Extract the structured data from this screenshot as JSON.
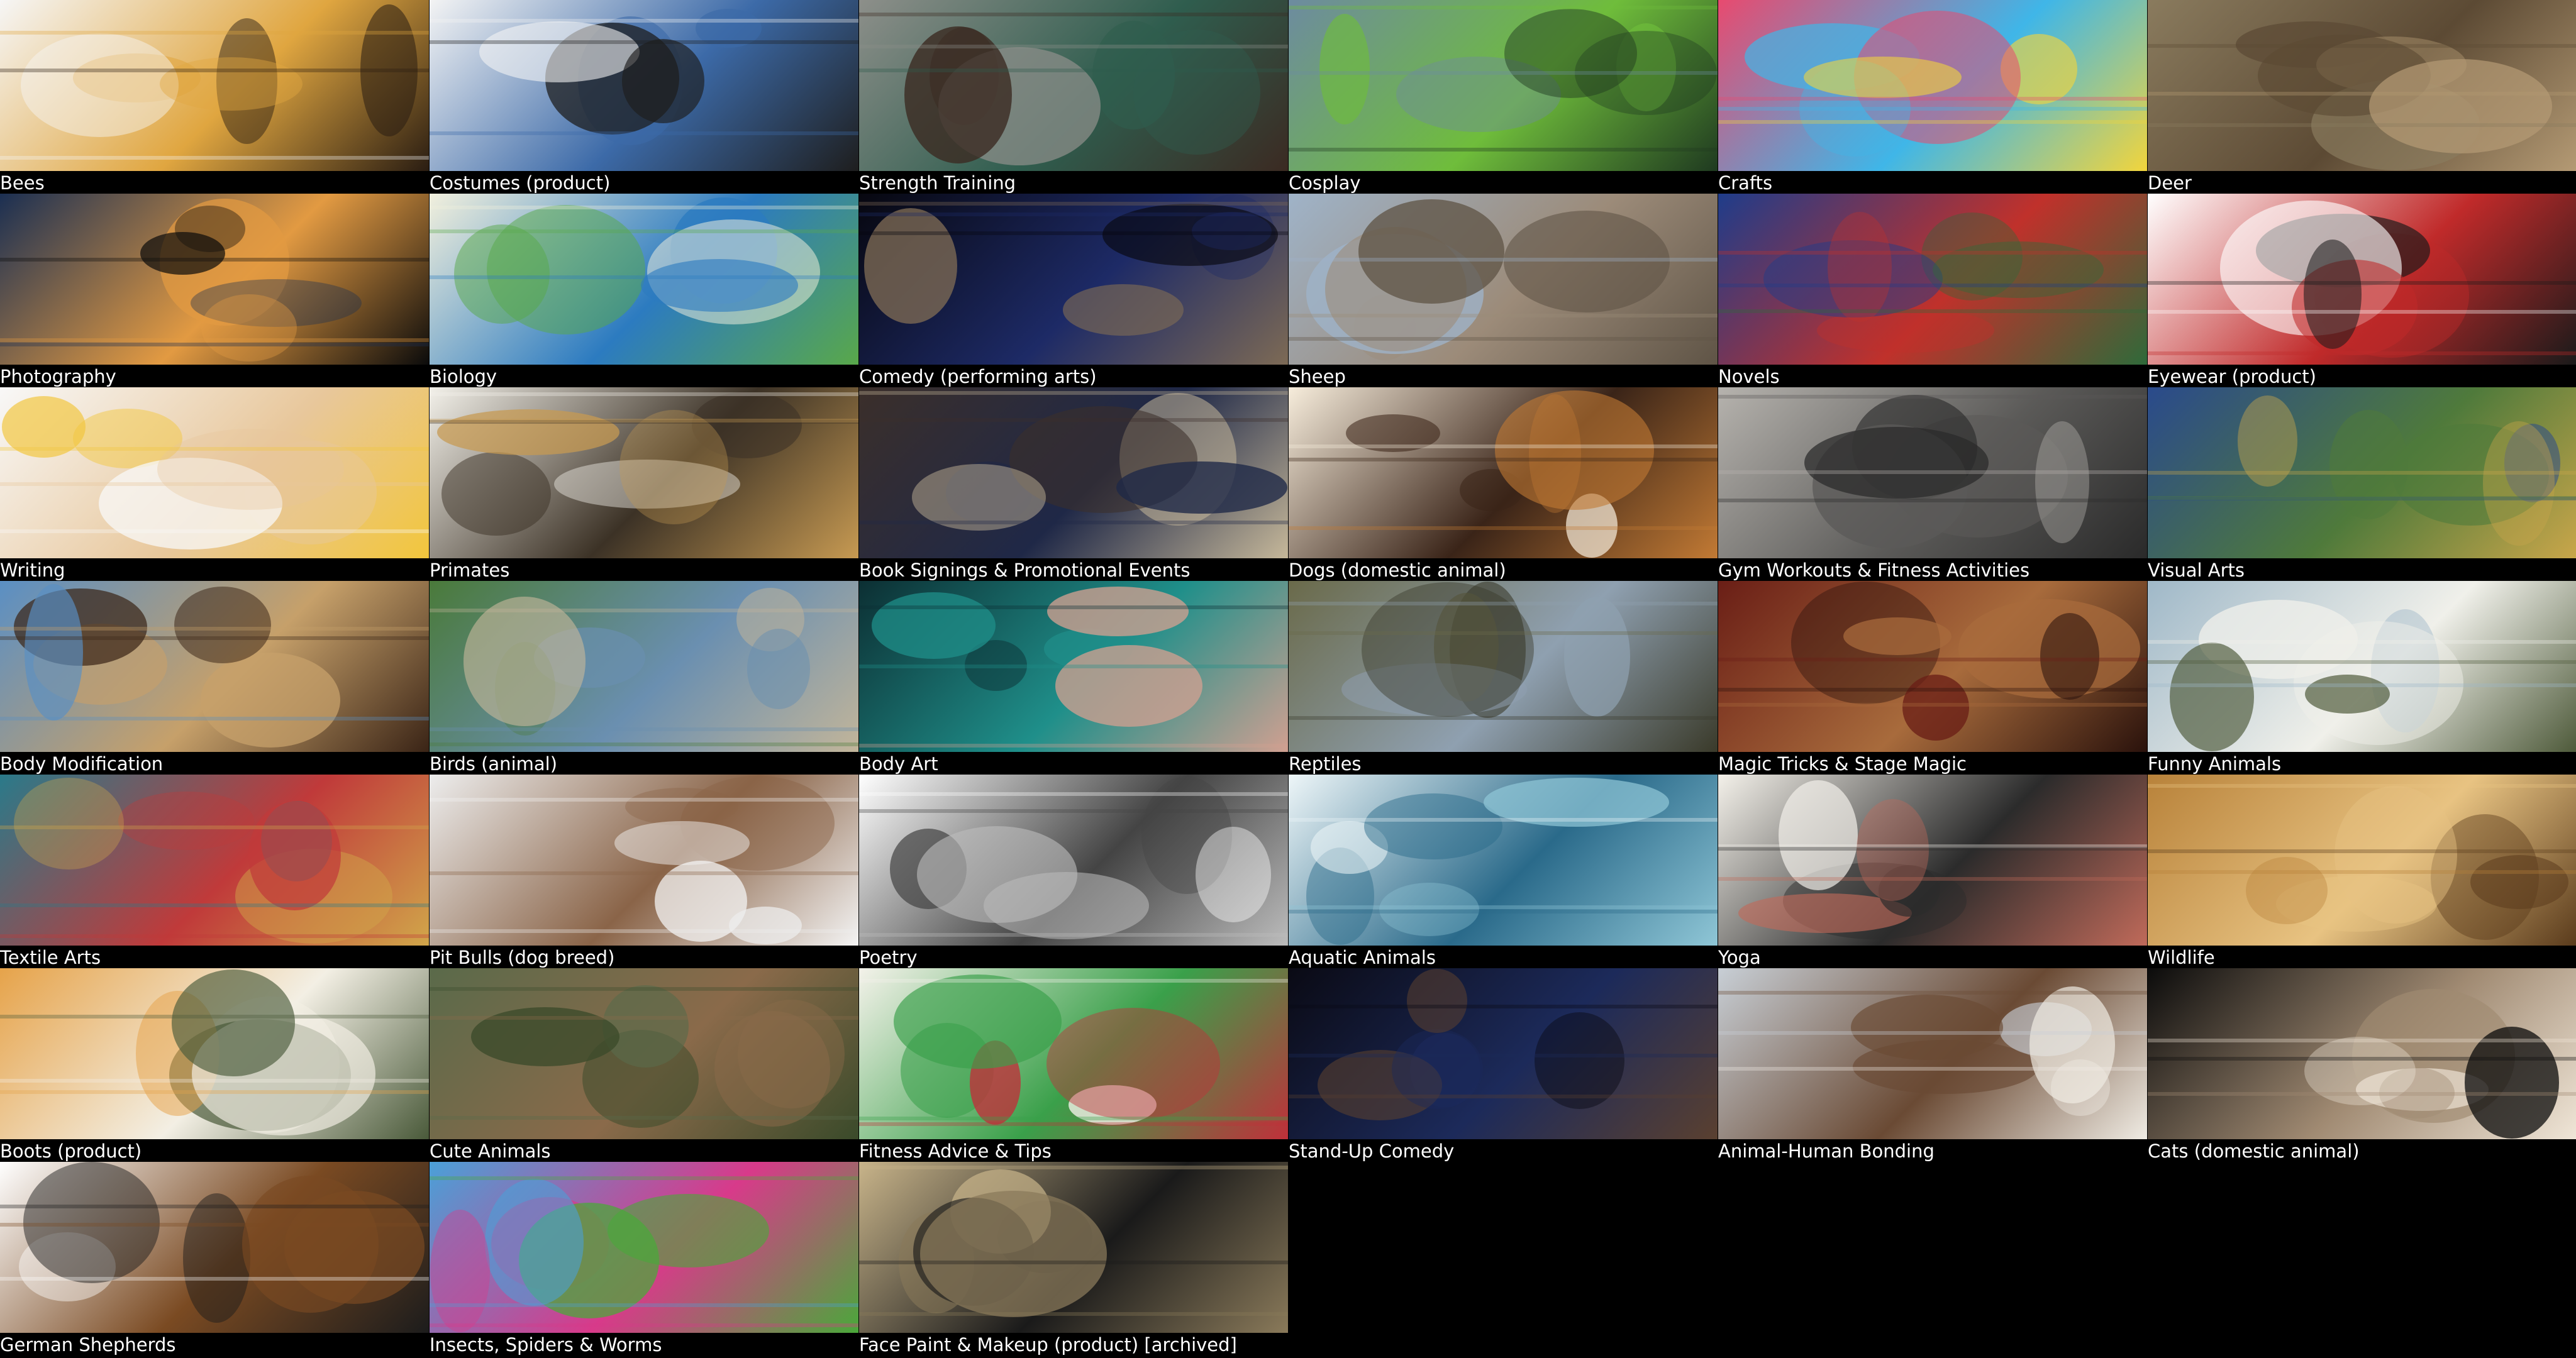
{
  "gallery": {
    "tiles": [
      {
        "label": "Bees",
        "icon": "bee-photo",
        "colors": [
          "#f6f6f6",
          "#e0a640",
          "#2a1d12"
        ]
      },
      {
        "label": "Costumes (product)",
        "icon": "costume-photo",
        "colors": [
          "#f4f4f4",
          "#3c6aa8",
          "#1e1e1e"
        ]
      },
      {
        "label": "Strength Training",
        "icon": "weightlifting-photo",
        "colors": [
          "#8d8f8a",
          "#2f5d4e",
          "#3b2a22"
        ]
      },
      {
        "label": "Cosplay",
        "icon": "cosplay-photo",
        "colors": [
          "#6d8ba0",
          "#6fbd3b",
          "#1f3a20"
        ]
      },
      {
        "label": "Crafts",
        "icon": "craft-supplies-photo",
        "colors": [
          "#e84a6f",
          "#3fb6e8",
          "#f2d53c"
        ]
      },
      {
        "label": "Deer",
        "icon": "deer-photo",
        "colors": [
          "#8a7b5e",
          "#5c4a34",
          "#b49a74"
        ]
      },
      {
        "label": "Photography",
        "icon": "camera-photo",
        "colors": [
          "#1b2f52",
          "#e29a42",
          "#0b0b0b"
        ]
      },
      {
        "label": "Biology",
        "icon": "biology-infographic",
        "colors": [
          "#f2f0dd",
          "#2c7bc0",
          "#59a84a"
        ]
      },
      {
        "label": "Comedy (performing arts)",
        "icon": "stage-photo",
        "colors": [
          "#07070f",
          "#1d2a66",
          "#7d6a55"
        ]
      },
      {
        "label": "Sheep",
        "icon": "sheep-photo",
        "colors": [
          "#9fb3c8",
          "#9c8b79",
          "#5f5446"
        ]
      },
      {
        "label": "Novels",
        "icon": "book-covers-photo",
        "colors": [
          "#1f3c8a",
          "#c0312b",
          "#2f6a3a"
        ]
      },
      {
        "label": "Eyewear (product)",
        "icon": "sunglasses-photo",
        "colors": [
          "#ffffff",
          "#c02a2a",
          "#1a1a1a"
        ]
      },
      {
        "label": "Writing",
        "icon": "hand-writing-photo",
        "colors": [
          "#f8f8f8",
          "#e8c79b",
          "#f2c63c"
        ]
      },
      {
        "label": "Primates",
        "icon": "primates-illustration",
        "colors": [
          "#f3f1ea",
          "#3c3226",
          "#c79a52"
        ]
      },
      {
        "label": "Book Signings & Promotional Events",
        "icon": "book-signing-photo",
        "colors": [
          "#3b2f2a",
          "#1f2847",
          "#c6b89a"
        ]
      },
      {
        "label": "Dogs (domestic animal)",
        "icon": "puppy-photo",
        "colors": [
          "#f7eddc",
          "#3a2418",
          "#c27a34"
        ]
      },
      {
        "label": "Gym Workouts & Fitness Activities",
        "icon": "gym-photo",
        "colors": [
          "#b6b3ae",
          "#5b5a58",
          "#2a2a2a"
        ]
      },
      {
        "label": "Visual Arts",
        "icon": "painting-photo",
        "colors": [
          "#2a4a8c",
          "#4f7a3b",
          "#c9a64a"
        ]
      },
      {
        "label": "Body Modification",
        "icon": "tribal-portrait-photo",
        "colors": [
          "#5a8fc4",
          "#c6a06a",
          "#3a2416"
        ]
      },
      {
        "label": "Birds (animal)",
        "icon": "birds-collage",
        "colors": [
          "#4a7a3a",
          "#6a8fb0",
          "#c2b59a"
        ]
      },
      {
        "label": "Body Art",
        "icon": "makeup-portrait-photo",
        "colors": [
          "#0c2f33",
          "#1f8f8a",
          "#d1a091"
        ]
      },
      {
        "label": "Reptiles",
        "icon": "reptiles-collage",
        "colors": [
          "#6a6a4a",
          "#8fa0b0",
          "#3a3a2a"
        ]
      },
      {
        "label": "Magic Tricks & Stage Magic",
        "icon": "magician-photo",
        "colors": [
          "#6a1e16",
          "#a86b3c",
          "#2a120c"
        ]
      },
      {
        "label": "Funny Animals",
        "icon": "goat-photo",
        "colors": [
          "#9fb8c8",
          "#f0f0ea",
          "#4e5a3a"
        ]
      },
      {
        "label": "Textile Arts",
        "icon": "textile-photo",
        "colors": [
          "#2a7a8a",
          "#c03a3a",
          "#d1a64a"
        ]
      },
      {
        "label": "Pit Bulls (dog breed)",
        "icon": "pitbull-photo",
        "colors": [
          "#ededed",
          "#8a6448",
          "#f4f4f4"
        ]
      },
      {
        "label": "Poetry",
        "icon": "poem-text-image",
        "colors": [
          "#ffffff",
          "#444444",
          "#bcbcbc"
        ]
      },
      {
        "label": "Aquatic Animals",
        "icon": "aquatic-animals-chart",
        "colors": [
          "#eef6f8",
          "#2a6a8a",
          "#8fc6d6"
        ]
      },
      {
        "label": "Yoga",
        "icon": "yoga-photo",
        "colors": [
          "#f4f1ea",
          "#2b2b2b",
          "#c06a5a"
        ]
      },
      {
        "label": "Wildlife",
        "icon": "lion-cub-photo",
        "colors": [
          "#b8823a",
          "#e8c382",
          "#5a3b1c"
        ]
      },
      {
        "label": "Boots (product)",
        "icon": "skincare-products-photo",
        "colors": [
          "#e6a34a",
          "#f3efe4",
          "#4a5a3a"
        ]
      },
      {
        "label": "Cute Animals",
        "icon": "quokka-photo",
        "colors": [
          "#5a6a4a",
          "#8a6a4a",
          "#3a4a2a"
        ]
      },
      {
        "label": "Fitness Advice & Tips",
        "icon": "fitness-infographic",
        "colors": [
          "#f4f2ea",
          "#3aa04a",
          "#c0303a"
        ]
      },
      {
        "label": "Stand-Up Comedy",
        "icon": "comedian-photo",
        "colors": [
          "#0a0a14",
          "#1c2a5a",
          "#5a4030"
        ]
      },
      {
        "label": "Animal-Human Bonding",
        "icon": "man-with-dog-photo",
        "colors": [
          "#c8cfd6",
          "#6a4a34",
          "#f0ece4"
        ]
      },
      {
        "label": "Cats (domestic animal)",
        "icon": "cat-photo",
        "colors": [
          "#0b0b0b",
          "#a08a72",
          "#f0e6d8"
        ]
      },
      {
        "label": "German Shepherds",
        "icon": "german-shepherd-photo",
        "colors": [
          "#ffffff",
          "#7a4a22",
          "#1c1c1c"
        ]
      },
      {
        "label": "Insects, Spiders & Worms",
        "icon": "insects-book-cover",
        "colors": [
          "#4aa0d8",
          "#d83a8a",
          "#4aa83a"
        ]
      },
      {
        "label": "Face Paint & Makeup (product) [archived]",
        "icon": "vintage-ad-image",
        "colors": [
          "#c8b48a",
          "#1a1a1a",
          "#8a7a5a"
        ]
      }
    ]
  }
}
